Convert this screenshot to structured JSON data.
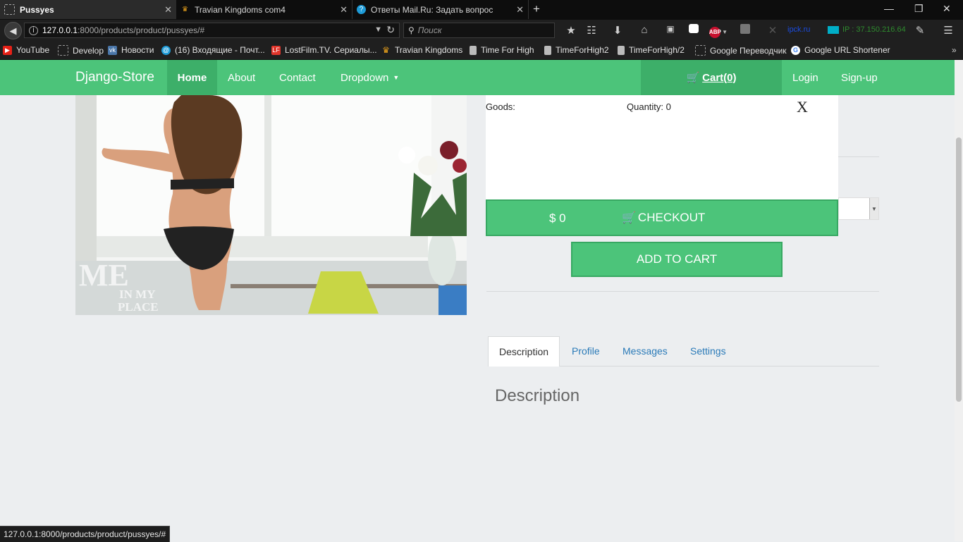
{
  "browser": {
    "tabs": [
      {
        "title": "Pussyes",
        "active": true,
        "icon": "page-icon"
      },
      {
        "title": "Travian Kingdoms com4",
        "active": false,
        "icon": "crown-icon"
      },
      {
        "title": "Ответы Mail.Ru: Задать вопрос",
        "active": false,
        "icon": "question-icon"
      }
    ],
    "new_tab": "+",
    "url_host": "127.0.0.1",
    "url_rest": ":8000/products/product/pussyes/#",
    "search_placeholder": "Поиск",
    "toolbar_ext_text": "ipck.ru",
    "toolbar_ip": "IP : 37.150.216.64",
    "bookmarks": [
      {
        "label": "YouTube",
        "icon": "youtube-icon",
        "color": "#e62117"
      },
      {
        "label": "Develop",
        "icon": "folder-icon",
        "color": "#888888"
      },
      {
        "label": "Новости",
        "icon": "vk-icon",
        "color": "#4a76a8"
      },
      {
        "label": "(16) Входящие - Почт...",
        "icon": "mail-icon",
        "color": "#1e9bd7"
      },
      {
        "label": "LostFilm.TV. Сериалы...",
        "icon": "lostfilm-icon",
        "color": "#e0352b"
      },
      {
        "label": "Travian Kingdoms",
        "icon": "crown-icon",
        "color": "#e8a11c"
      },
      {
        "label": "Time For High",
        "icon": "page-icon",
        "color": "#bbbbbb"
      },
      {
        "label": "TimeForHigh2",
        "icon": "page-icon",
        "color": "#bbbbbb"
      },
      {
        "label": "TimeForHigh/2",
        "icon": "page-icon",
        "color": "#bbbbbb"
      },
      {
        "label": "Google Переводчик",
        "icon": "page-icon",
        "color": "#bbbbbb"
      },
      {
        "label": "Google URL Shortener",
        "icon": "google-icon",
        "color": "#4285f4"
      }
    ]
  },
  "site": {
    "brand": "Django-Store",
    "nav": [
      {
        "label": "Home",
        "active": true
      },
      {
        "label": "About",
        "active": false
      },
      {
        "label": "Contact",
        "active": false
      },
      {
        "label": "Dropdown",
        "active": false
      }
    ],
    "cart_label": "Cart(0)",
    "login": "Login",
    "signup": "Sign-up",
    "accent": "#4cc47a"
  },
  "product": {
    "watermark_big": "ME",
    "watermark_small1": "IN MY",
    "watermark_small2": "PLACE"
  },
  "cart_panel": {
    "goods_label": "Goods:",
    "quantity_label": "Quantity: 0",
    "close_label": "X",
    "total": "$ 0",
    "checkout_label": "CHECKOUT"
  },
  "add_to_cart": "ADD TO CART",
  "tabs": [
    {
      "label": "Description",
      "active": true
    },
    {
      "label": "Profile",
      "active": false
    },
    {
      "label": "Messages",
      "active": false
    },
    {
      "label": "Settings",
      "active": false
    }
  ],
  "tab_content_heading": "Description",
  "status_url": "127.0.0.1:8000/products/product/pussyes/#"
}
